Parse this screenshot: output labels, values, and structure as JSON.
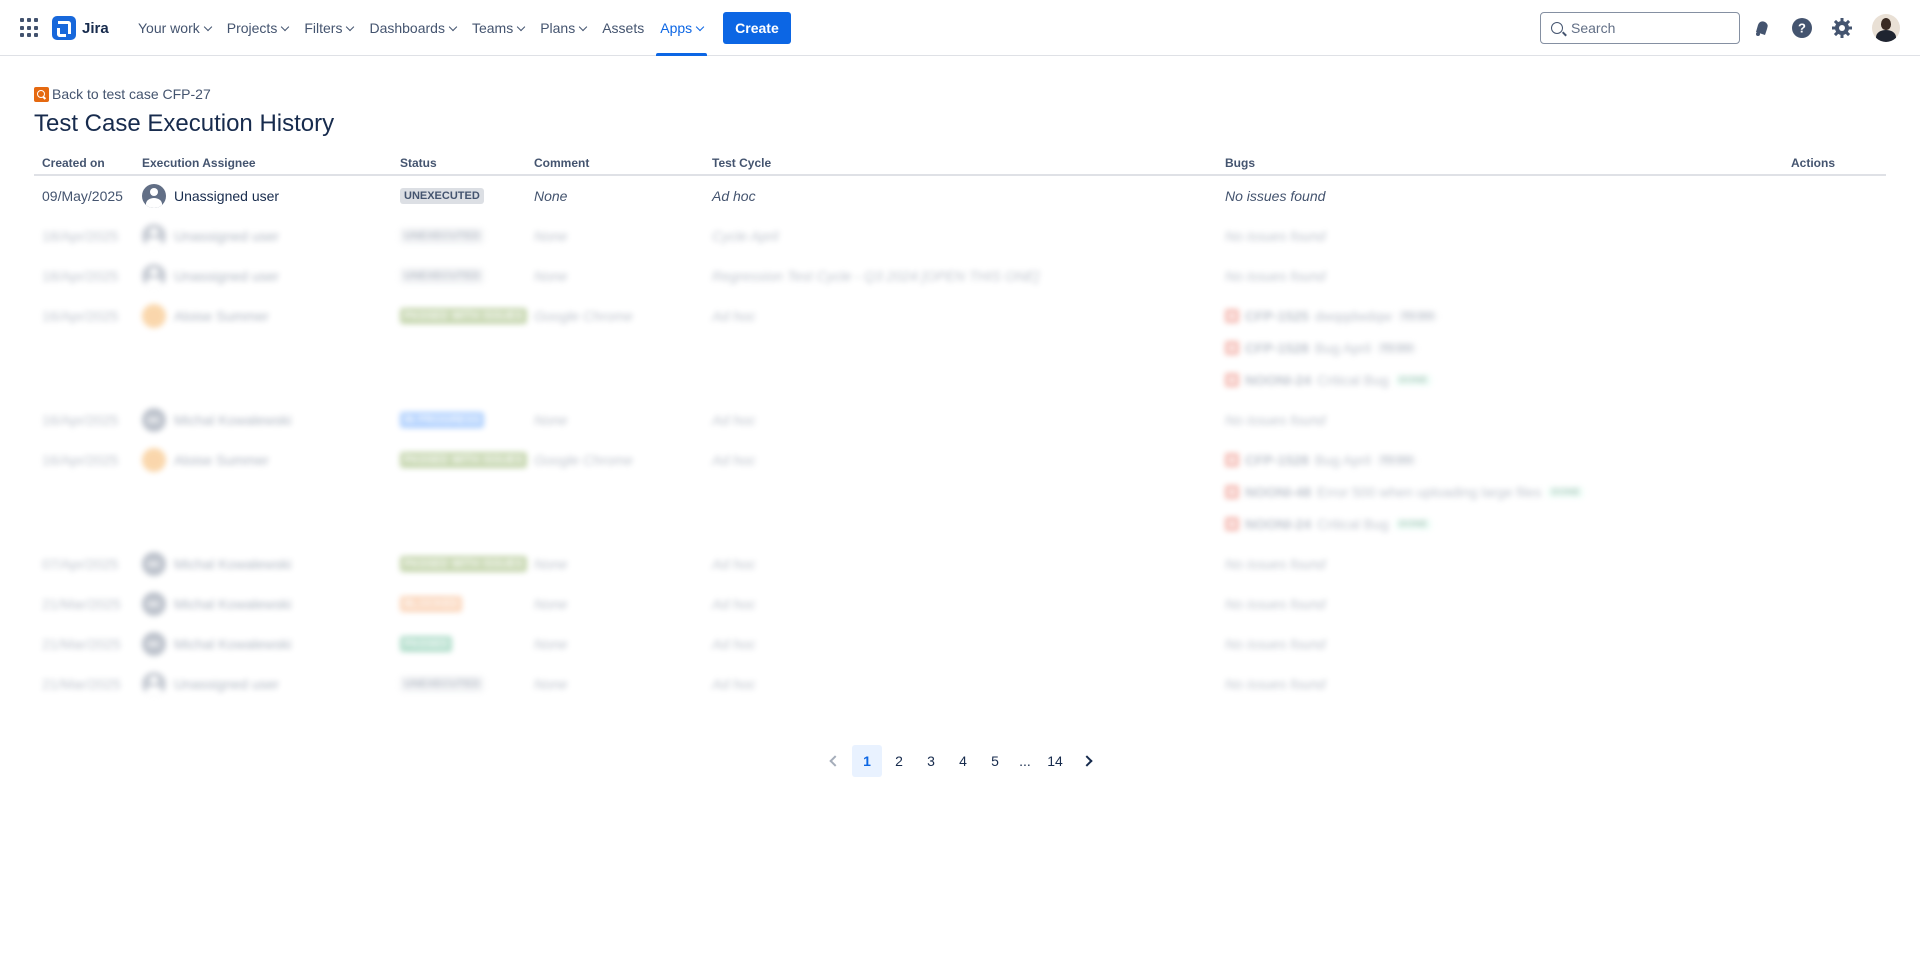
{
  "app": {
    "name": "Jira"
  },
  "nav": {
    "items": [
      {
        "label": "Your work",
        "dropdown": true
      },
      {
        "label": "Projects",
        "dropdown": true
      },
      {
        "label": "Filters",
        "dropdown": true
      },
      {
        "label": "Dashboards",
        "dropdown": true
      },
      {
        "label": "Teams",
        "dropdown": true
      },
      {
        "label": "Plans",
        "dropdown": true
      },
      {
        "label": "Assets",
        "dropdown": false
      },
      {
        "label": "Apps",
        "dropdown": true,
        "active": true
      }
    ],
    "create_label": "Create",
    "search_placeholder": "Search"
  },
  "page": {
    "back_link": "Back to test case CFP-27",
    "title": "Test Case Execution History"
  },
  "table": {
    "headers": {
      "created_on": "Created on",
      "assignee": "Execution Assignee",
      "status": "Status",
      "comment": "Comment",
      "test_cycle": "Test Cycle",
      "bugs": "Bugs",
      "actions": "Actions"
    },
    "rows": [
      {
        "date": "09/May/2025",
        "assignee": "Unassigned user",
        "avatar": "unassigned",
        "status": "UNEXECUTED",
        "status_color": "grey",
        "comment": "None",
        "cycle": "Ad hoc",
        "bugs": [],
        "no_bugs": "No issues found",
        "blurred": false,
        "height": 40
      },
      {
        "date": "18/Apr/2025",
        "assignee": "Unassigned user",
        "avatar": "unassigned",
        "status": "UNEXECUTED",
        "status_color": "grey",
        "comment": "None",
        "cycle": "Cycle April",
        "bugs": [],
        "no_bugs": "No issues found",
        "blurred": true,
        "height": 40
      },
      {
        "date": "18/Apr/2025",
        "assignee": "Unassigned user",
        "avatar": "unassigned",
        "status": "UNEXECUTED",
        "status_color": "grey",
        "comment": "None",
        "cycle": "Regression Test Cycle - Q3 2024 [OPEN THIS ONE]",
        "bugs": [],
        "no_bugs": "No issues found",
        "blurred": true,
        "height": 40
      },
      {
        "date": "16/Apr/2025",
        "assignee": "Aloise Summer",
        "avatar": "orange",
        "status": "PASSED WITH ISSUES",
        "status_color": "green",
        "comment": "Google Chrome",
        "cycle": "Ad hoc",
        "bugs": [
          {
            "key": "CFP-1525",
            "summary": "dwqqdwdqw",
            "lozenge": "TO DO",
            "lz": "todo"
          },
          {
            "key": "CFP-1528",
            "summary": "Bug April",
            "lozenge": "TO DO",
            "lz": "todo"
          },
          {
            "key": "NOONI-24",
            "summary": "Critical Bug",
            "lozenge": "DONE",
            "lz": "done"
          }
        ],
        "no_bugs": "",
        "blurred": true,
        "height": 104
      },
      {
        "date": "16/Apr/2025",
        "assignee": "Michal Kowalewski",
        "avatar": "initials",
        "initials": "MK",
        "status": "IN PROGRESS",
        "status_color": "blue",
        "comment": "None",
        "cycle": "Ad hoc",
        "bugs": [],
        "no_bugs": "No issues found",
        "blurred": true,
        "height": 40
      },
      {
        "date": "16/Apr/2025",
        "assignee": "Aloise Summer",
        "avatar": "orange",
        "status": "PASSED WITH ISSUES",
        "status_color": "green",
        "comment": "Google Chrome",
        "cycle": "Ad hoc",
        "bugs": [
          {
            "key": "CFP-1528",
            "summary": "Bug April",
            "lozenge": "TO DO",
            "lz": "todo"
          },
          {
            "key": "NOONI-48",
            "summary": "Error 500 when uploading large files",
            "lozenge": "DONE",
            "lz": "done"
          },
          {
            "key": "NOONI-24",
            "summary": "Critical Bug",
            "lozenge": "DONE",
            "lz": "done"
          }
        ],
        "no_bugs": "",
        "blurred": true,
        "height": 104
      },
      {
        "date": "07/Apr/2025",
        "assignee": "Michal Kowalewski",
        "avatar": "initials",
        "initials": "MK",
        "status": "PASSED WITH ISSUES",
        "status_color": "green",
        "comment": "None",
        "cycle": "Ad hoc",
        "bugs": [],
        "no_bugs": "No issues found",
        "blurred": true,
        "height": 40
      },
      {
        "date": "21/Mar/2025",
        "assignee": "Michal Kowalewski",
        "avatar": "initials",
        "initials": "MK",
        "status": "BLOCKED",
        "status_color": "orange",
        "comment": "None",
        "cycle": "Ad hoc",
        "bugs": [],
        "no_bugs": "No issues found",
        "blurred": true,
        "height": 40
      },
      {
        "date": "21/Mar/2025",
        "assignee": "Michal Kowalewski",
        "avatar": "initials",
        "initials": "MK",
        "status": "PASSED",
        "status_color": "teal",
        "comment": "None",
        "cycle": "Ad hoc",
        "bugs": [],
        "no_bugs": "No issues found",
        "blurred": true,
        "height": 40
      },
      {
        "date": "21/Mar/2025",
        "assignee": "Unassigned user",
        "avatar": "unassigned",
        "status": "UNEXECUTED",
        "status_color": "grey",
        "comment": "None",
        "cycle": "Ad hoc",
        "bugs": [],
        "no_bugs": "No issues found",
        "blurred": true,
        "height": 40
      }
    ]
  },
  "pagination": {
    "pages": [
      "1",
      "2",
      "3",
      "4",
      "5",
      "...",
      "14"
    ],
    "current": "1"
  }
}
